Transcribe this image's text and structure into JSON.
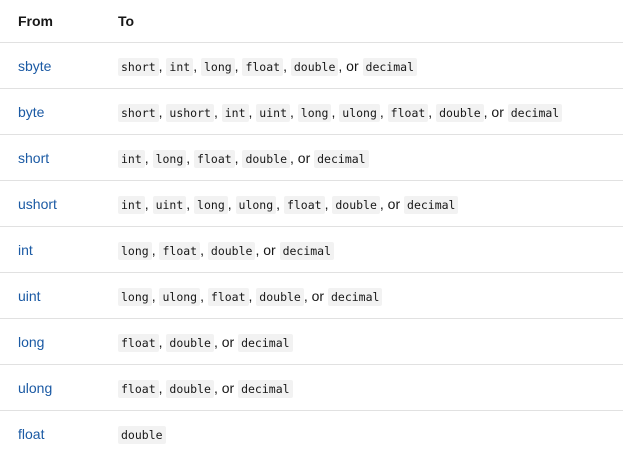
{
  "table": {
    "headers": {
      "from": "From",
      "to": "To"
    },
    "rows": [
      {
        "from": "sbyte",
        "to": [
          "short",
          "int",
          "long",
          "float",
          "double",
          "decimal"
        ]
      },
      {
        "from": "byte",
        "to": [
          "short",
          "ushort",
          "int",
          "uint",
          "long",
          "ulong",
          "float",
          "double",
          "decimal"
        ]
      },
      {
        "from": "short",
        "to": [
          "int",
          "long",
          "float",
          "double",
          "decimal"
        ]
      },
      {
        "from": "ushort",
        "to": [
          "int",
          "uint",
          "long",
          "ulong",
          "float",
          "double",
          "decimal"
        ]
      },
      {
        "from": "int",
        "to": [
          "long",
          "float",
          "double",
          "decimal"
        ]
      },
      {
        "from": "uint",
        "to": [
          "long",
          "ulong",
          "float",
          "double",
          "decimal"
        ]
      },
      {
        "from": "long",
        "to": [
          "float",
          "double",
          "decimal"
        ]
      },
      {
        "from": "ulong",
        "to": [
          "float",
          "double",
          "decimal"
        ]
      },
      {
        "from": "float",
        "to": [
          "double"
        ]
      }
    ],
    "separators": {
      "comma": ", ",
      "or": ", or "
    }
  },
  "colors": {
    "link": "#1b5aa4",
    "code_bg": "#f2f2f2",
    "border": "#e1e1e1",
    "text": "#171717"
  }
}
